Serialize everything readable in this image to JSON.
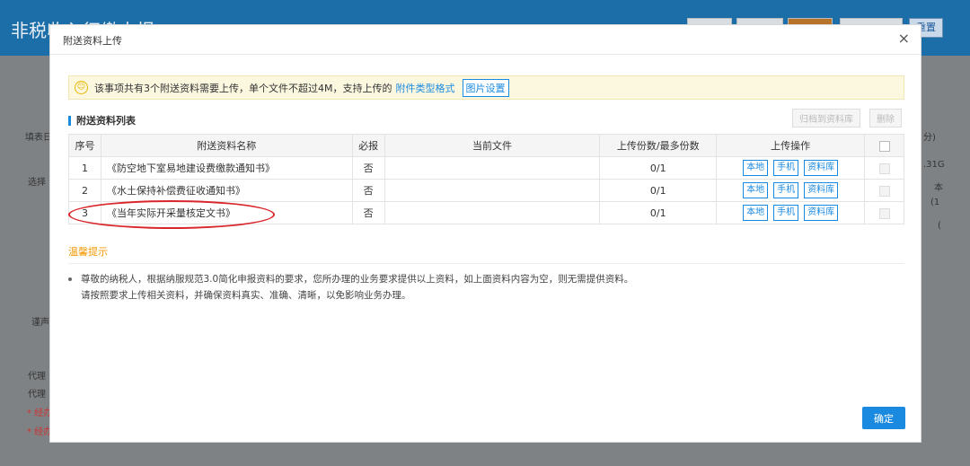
{
  "background": {
    "app_title": "非税收入征缴申报",
    "right_button": "重置",
    "side_labels": [
      "填表日",
      "选择",
      "代理",
      "代理",
      "* 经办",
      "* 经办",
      "谨声"
    ],
    "right_labels": [
      "分)",
      ".31G",
      "本",
      "(1",
      "("
    ]
  },
  "modal": {
    "title": "附送资料上传",
    "close_label": "×",
    "notice": {
      "icon": "smile-icon",
      "text": "该事项共有3个附送资料需要上传，单个文件不超过4M，支持上传的",
      "link": "附件类型格式",
      "button": "图片设置"
    },
    "section_title": "附送资料列表",
    "archive_button": "归档到资料库",
    "delete_button": "删除",
    "table": {
      "headers": [
        "序号",
        "附送资料名称",
        "必报",
        "当前文件",
        "上传份数/最多份数",
        "上传操作"
      ],
      "rows": [
        {
          "no": "1",
          "name": "《防空地下室易地建设费缴款通知书》",
          "required": "否",
          "file": "",
          "count": "0/1"
        },
        {
          "no": "2",
          "name": "《水土保持补偿费征收通知书》",
          "required": "否",
          "file": "",
          "count": "0/1"
        },
        {
          "no": "3",
          "name": "《当年实际开采量核定文书》",
          "required": "否",
          "file": "",
          "count": "0/1"
        }
      ],
      "ops": [
        "本地",
        "手机",
        "资料库"
      ]
    },
    "tips_title": "温馨提示",
    "tips_line1": "尊敬的纳税人，根据纳服规范3.0简化申报资料的要求，您所办理的业务要求提供以上资料，如上面资料内容为空，则无需提供资料。",
    "tips_line2": "请按照要求上传相关资料，并确保资料真实、准确、清晰，以免影响业务办理。",
    "ok_button": "确定"
  }
}
